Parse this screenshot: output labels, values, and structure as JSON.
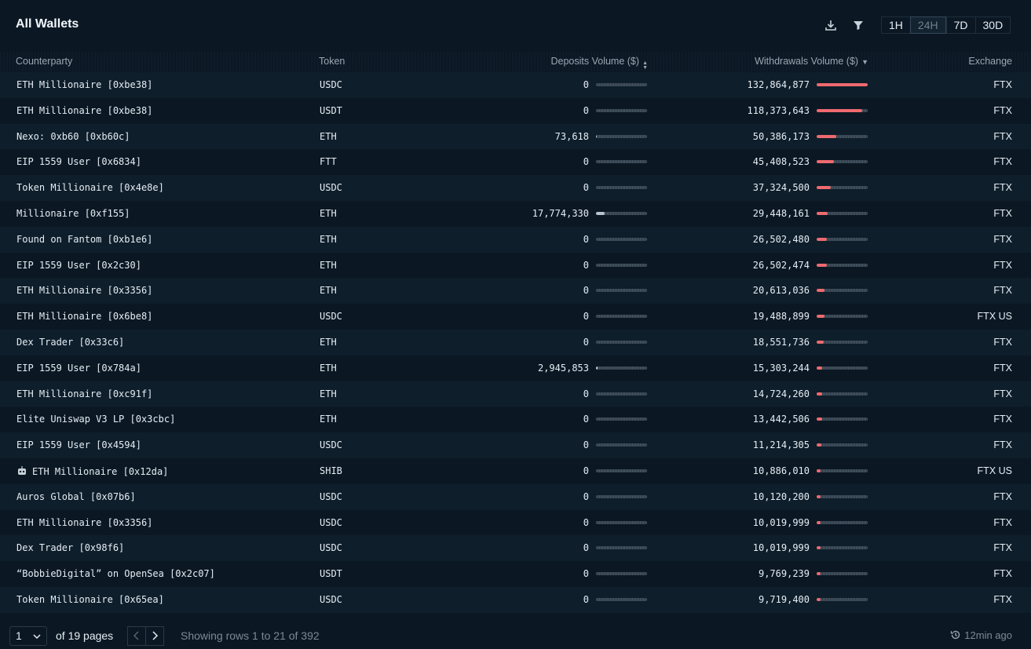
{
  "header": {
    "title": "All Wallets",
    "ranges": [
      "1H",
      "24H",
      "7D",
      "30D"
    ],
    "active_range": "24H"
  },
  "columns": {
    "counterparty": "Counterparty",
    "token": "Token",
    "deposits": "Deposits Volume ($)",
    "withdrawals": "Withdrawals Volume ($)",
    "exchange": "Exchange"
  },
  "rows": [
    {
      "counterparty": "ETH Millionaire [0xbe38]",
      "token": "USDC",
      "deposits": "0",
      "deposit_level": 0,
      "withdrawals": "132,864,877",
      "withdrawal_level": 1.0,
      "exchange": "FTX"
    },
    {
      "counterparty": "ETH Millionaire [0xbe38]",
      "token": "USDT",
      "deposits": "0",
      "deposit_level": 0,
      "withdrawals": "118,373,643",
      "withdrawal_level": 0.89,
      "exchange": "FTX"
    },
    {
      "counterparty": "Nexo: 0xb60 [0xb60c]",
      "token": "ETH",
      "deposits": "73,618",
      "deposit_level": 0.004,
      "withdrawals": "50,386,173",
      "withdrawal_level": 0.38,
      "exchange": "FTX"
    },
    {
      "counterparty": "EIP 1559 User [0x6834]",
      "token": "FTT",
      "deposits": "0",
      "deposit_level": 0,
      "withdrawals": "45,408,523",
      "withdrawal_level": 0.34,
      "exchange": "FTX"
    },
    {
      "counterparty": "Token Millionaire [0x4e8e]",
      "token": "USDC",
      "deposits": "0",
      "deposit_level": 0,
      "withdrawals": "37,324,500",
      "withdrawal_level": 0.28,
      "exchange": "FTX"
    },
    {
      "counterparty": "Millionaire [0xf155]",
      "token": "ETH",
      "deposits": "17,774,330",
      "deposit_level": 0.17,
      "withdrawals": "29,448,161",
      "withdrawal_level": 0.22,
      "exchange": "FTX"
    },
    {
      "counterparty": "Found on Fantom [0xb1e6]",
      "token": "ETH",
      "deposits": "0",
      "deposit_level": 0,
      "withdrawals": "26,502,480",
      "withdrawal_level": 0.2,
      "exchange": "FTX"
    },
    {
      "counterparty": "EIP 1559 User [0x2c30]",
      "token": "ETH",
      "deposits": "0",
      "deposit_level": 0,
      "withdrawals": "26,502,474",
      "withdrawal_level": 0.2,
      "exchange": "FTX"
    },
    {
      "counterparty": "ETH Millionaire [0x3356]",
      "token": "ETH",
      "deposits": "0",
      "deposit_level": 0,
      "withdrawals": "20,613,036",
      "withdrawal_level": 0.155,
      "exchange": "FTX"
    },
    {
      "counterparty": "ETH Millionaire [0x6be8]",
      "token": "USDC",
      "deposits": "0",
      "deposit_level": 0,
      "withdrawals": "19,488,899",
      "withdrawal_level": 0.147,
      "exchange": "FTX US"
    },
    {
      "counterparty": "Dex Trader [0x33c6]",
      "token": "ETH",
      "deposits": "0",
      "deposit_level": 0,
      "withdrawals": "18,551,736",
      "withdrawal_level": 0.14,
      "exchange": "FTX"
    },
    {
      "counterparty": "EIP 1559 User [0x784a]",
      "token": "ETH",
      "deposits": "2,945,853",
      "deposit_level": 0.03,
      "withdrawals": "15,303,244",
      "withdrawal_level": 0.115,
      "exchange": "FTX"
    },
    {
      "counterparty": "ETH Millionaire [0xc91f]",
      "token": "ETH",
      "deposits": "0",
      "deposit_level": 0,
      "withdrawals": "14,724,260",
      "withdrawal_level": 0.11,
      "exchange": "FTX"
    },
    {
      "counterparty": "Elite Uniswap V3 LP [0x3cbc]",
      "token": "ETH",
      "deposits": "0",
      "deposit_level": 0,
      "withdrawals": "13,442,506",
      "withdrawal_level": 0.1,
      "exchange": "FTX"
    },
    {
      "counterparty": "EIP 1559 User [0x4594]",
      "token": "USDC",
      "deposits": "0",
      "deposit_level": 0,
      "withdrawals": "11,214,305",
      "withdrawal_level": 0.085,
      "exchange": "FTX"
    },
    {
      "counterparty": "ETH Millionaire [0x12da]",
      "token": "SHIB",
      "deposits": "0",
      "deposit_level": 0,
      "withdrawals": "10,886,010",
      "withdrawal_level": 0.082,
      "exchange": "FTX US",
      "icon": "robot-emoji-icon"
    },
    {
      "counterparty": "Auros Global [0x07b6]",
      "token": "USDC",
      "deposits": "0",
      "deposit_level": 0,
      "withdrawals": "10,120,200",
      "withdrawal_level": 0.076,
      "exchange": "FTX"
    },
    {
      "counterparty": "ETH Millionaire [0x3356]",
      "token": "USDC",
      "deposits": "0",
      "deposit_level": 0,
      "withdrawals": "10,019,999",
      "withdrawal_level": 0.075,
      "exchange": "FTX"
    },
    {
      "counterparty": "Dex Trader [0x98f6]",
      "token": "USDC",
      "deposits": "0",
      "deposit_level": 0,
      "withdrawals": "10,019,999",
      "withdrawal_level": 0.075,
      "exchange": "FTX"
    },
    {
      "counterparty": "“BobbieDigital” on OpenSea [0x2c07]",
      "token": "USDT",
      "deposits": "0",
      "deposit_level": 0,
      "withdrawals": "9,769,239",
      "withdrawal_level": 0.074,
      "exchange": "FTX"
    },
    {
      "counterparty": "Token Millionaire [0x65ea]",
      "token": "USDC",
      "deposits": "0",
      "deposit_level": 0,
      "withdrawals": "9,719,400",
      "withdrawal_level": 0.073,
      "exchange": "FTX"
    }
  ],
  "footer": {
    "page_value": "1",
    "of_pages": "of 19 pages",
    "showing": "Showing rows 1 to 21 of 392",
    "updated": "12min ago"
  },
  "colors": {
    "background": "#0b1824",
    "withdraw_bar": "#ee6a6f",
    "deposit_bar": "#b9c3cc"
  }
}
